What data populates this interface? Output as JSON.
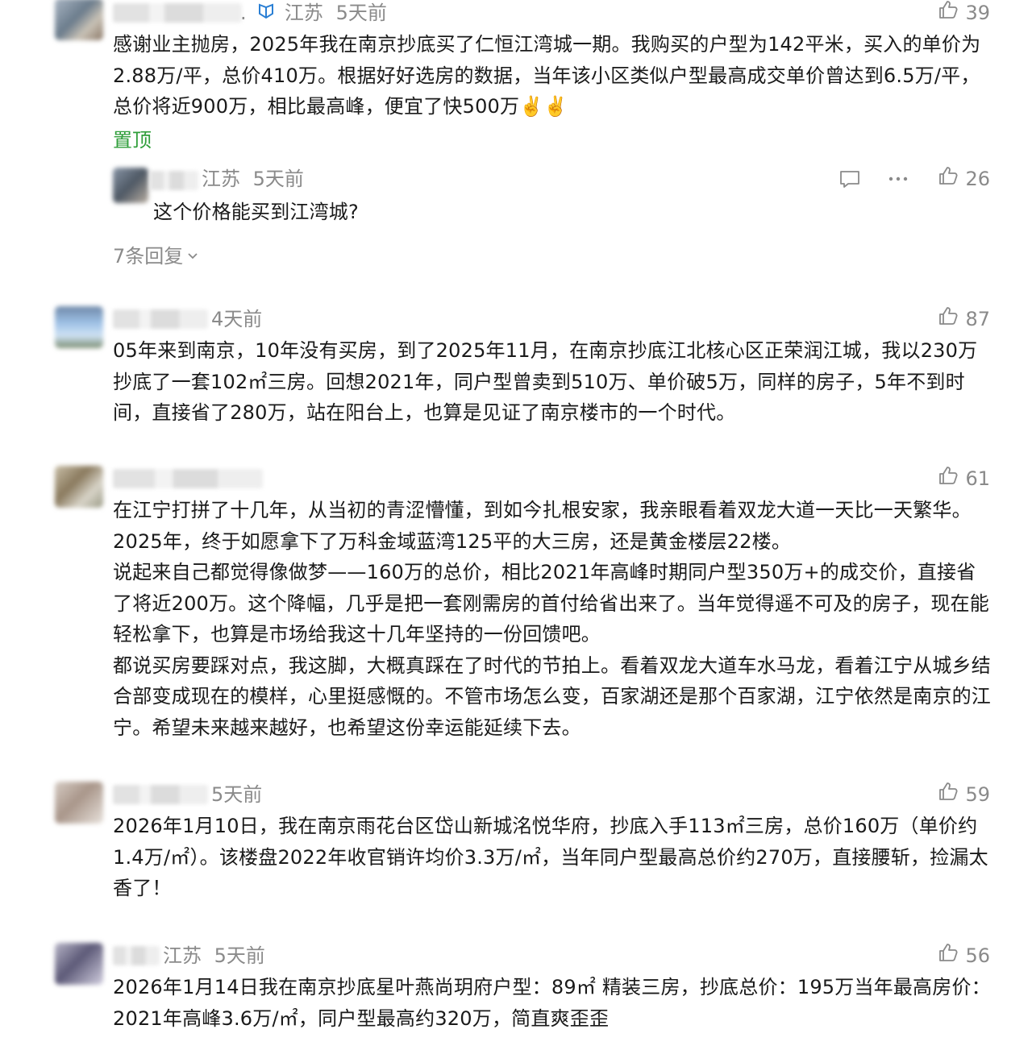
{
  "comments": [
    {
      "meta_prefix": ".",
      "region": "江苏",
      "time": "5天前",
      "likes": "39",
      "text": "感谢业主抛房，2025年我在南京抄底买了仁恒江湾城一期。我购买的户型为142平米，买入的单价为2.88万/平，总价410万。根据好好选房的数据，当年该小区类似户型最高成交单价曾达到6.5万/平，总价将近900万，相比最高峰，便宜了快500万✌️✌️",
      "pin_label": "置顶",
      "reply": {
        "region": "江苏",
        "time": "5天前",
        "likes": "26",
        "text": "这个价格能买到江湾城?"
      },
      "more_replies": "7条回复"
    },
    {
      "time": "4天前",
      "likes": "87",
      "text": "05年来到南京，10年没有买房，到了2025年11月，在南京抄底江北核心区正荣润江城，我以230万抄底了一套102㎡三房。回想2021年，同户型曾卖到510万、单价破5万，同样的房子，5年不到时间，直接省了280万，站在阳台上，也算是见证了南京楼市的一个时代。"
    },
    {
      "likes": "61",
      "paragraphs": [
        "在江宁打拼了十几年，从当初的青涩懵懂，到如今扎根安家，我亲眼看着双龙大道一天比一天繁华。2025年，终于如愿拿下了万科金域蓝湾125平的大三房，还是黄金楼层22楼。",
        "说起来自己都觉得像做梦——160万的总价，相比2021年高峰时期同户型350万+的成交价，直接省了将近200万。这个降幅，几乎是把一套刚需房的首付给省出来了。当年觉得遥不可及的房子，现在能轻松拿下，也算是市场给我这十几年坚持的一份回馈吧。",
        "都说买房要踩对点，我这脚，大概真踩在了时代的节拍上。看着双龙大道车水马龙，看着江宁从城乡结合部变成现在的模样，心里挺感慨的。不管市场怎么变，百家湖还是那个百家湖，江宁依然是南京的江宁。希望未来越来越好，也希望这份幸运能延续下去。"
      ]
    },
    {
      "time": "5天前",
      "likes": "59",
      "text": "2026年1月10日，我在南京雨花台区岱山新城洺悦华府，抄底入手113㎡三房，总价160万（单价约1.4万/㎡）。该楼盘2022年收官销许均价3.3万/㎡，当年同户型最高总价约270万，直接腰斩，捡漏太香了！"
    },
    {
      "region": "江苏",
      "time": "5天前",
      "likes": "56",
      "text": "2026年1月14日我在南京抄底星叶燕尚玥府户型：89㎡ 精装三房，抄底总价：195万当年最高房价：2021年高峰3.6万/㎡，同户型最高约320万，简直爽歪歪"
    }
  ],
  "colors": {
    "accent_green": "#2f9e3a",
    "meta_gray": "#8a8a8a",
    "text": "#1a1a1a"
  }
}
